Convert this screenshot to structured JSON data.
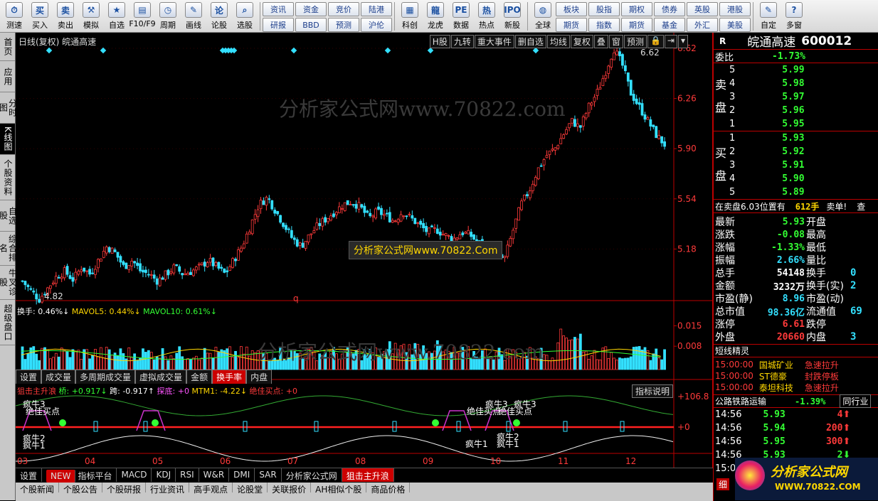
{
  "toolbar": {
    "main_buttons": [
      {
        "label": "测速",
        "icon": "speed-test-icon",
        "glyph": "⏱"
      },
      {
        "label": "买入",
        "icon": "buy-icon",
        "glyph": "买"
      },
      {
        "label": "卖出",
        "icon": "sell-icon",
        "glyph": "卖"
      },
      {
        "label": "模拟",
        "icon": "gavel-icon",
        "glyph": "⚒"
      },
      {
        "label": "自选",
        "icon": "star-icon",
        "glyph": "★"
      },
      {
        "label": "F10/F9",
        "icon": "f10-icon",
        "glyph": "▤"
      },
      {
        "label": "周期",
        "icon": "clock-icon",
        "glyph": "◷"
      },
      {
        "label": "画线",
        "icon": "pencil-icon",
        "glyph": "✎"
      },
      {
        "label": "论股",
        "icon": "forum-icon",
        "glyph": "论"
      },
      {
        "label": "选股",
        "icon": "magnifier-icon",
        "glyph": "⌕"
      }
    ],
    "grid_buttons_1": [
      "资讯",
      "资金",
      "竞价",
      "陆港",
      "研报",
      "BBD",
      "预测",
      "沪伦"
    ],
    "mid_buttons": [
      {
        "label": "科创",
        "icon": "star-market-icon",
        "glyph": "▦"
      },
      {
        "label": "龙虎",
        "icon": "dragon-icon",
        "glyph": "龍"
      },
      {
        "label": "数据",
        "icon": "pe-icon",
        "glyph": "PE"
      },
      {
        "label": "热点",
        "icon": "hot-icon",
        "glyph": "热"
      },
      {
        "label": "新股",
        "icon": "ipo-icon",
        "glyph": "IPO"
      }
    ],
    "globe_button": {
      "label": "全球",
      "icon": "globe-icon",
      "glyph": "◍"
    },
    "grid_buttons_2": [
      "板块",
      "股指",
      "期权",
      "债券",
      "英股",
      "港股",
      "期货",
      "指数",
      "期货",
      "基金",
      "外汇",
      "美股"
    ],
    "right_buttons": [
      {
        "label": "自定",
        "icon": "custom-icon",
        "glyph": "✎"
      },
      {
        "label": "多窗",
        "icon": "multi-window-icon",
        "glyph": "?"
      }
    ]
  },
  "left_nav": [
    {
      "label": "首页",
      "active": false
    },
    {
      "label": "应用",
      "active": false
    },
    {
      "label": "分时图",
      "active": false
    },
    {
      "label": "K线图",
      "active": true
    },
    {
      "label": "个股资料",
      "active": false
    },
    {
      "label": "自选股",
      "active": false
    },
    {
      "label": "综合排名",
      "active": false
    },
    {
      "label": "牛叉诊股",
      "active": false
    },
    {
      "label": "超级盘口",
      "active": false
    }
  ],
  "chart": {
    "title": "日线(复权) 皖通高速",
    "top_buttons": [
      "H股",
      "九转",
      "重大事件",
      "删自选",
      "均线",
      "复权",
      "叠",
      "窗",
      "预测"
    ],
    "watermark": "分析家公式网www.70822.com",
    "center_box": "分析家公式网www.70822.Com",
    "price_axis": [
      "6.62",
      "6.26",
      "5.90",
      "5.54",
      "5.18"
    ],
    "high_label": "6.62",
    "low_label": "4.82",
    "q_marker": "q",
    "volume_legend": {
      "a": "换手: 0.46%↓",
      "b": "MAVOL5: 0.44%↓",
      "c": "MAVOL10: 0.61%↓"
    },
    "volume_axis": [
      "0.015",
      "0.008"
    ],
    "volume_tabs": [
      "设置",
      "成交量",
      "多周期成交量",
      "虚拟成交量",
      "金额",
      "换手率",
      "内盘"
    ],
    "volume_tab_active": "换手率",
    "indicator_legend": {
      "name": "狙击主升浪",
      "a": "桥: +0.917↓",
      "b": "跨: -0.917↑",
      "c": "探底: +0",
      "d": "MTM1: -4.22↓",
      "e": "绝佳买点: +0"
    },
    "indicator_button": "指标说明",
    "indicator_axis": [
      "+106.8",
      "+0"
    ],
    "annotations": [
      "疯牛3",
      "绝佳买点",
      "疯牛1",
      "疯牛2",
      "疯牛3",
      "绝佳买点",
      "绝佳买点",
      "疯牛3",
      "疯牛1",
      "疯牛2",
      "疯牛1"
    ],
    "months": [
      "03",
      "04",
      "05",
      "06",
      "07",
      "08",
      "09",
      "10",
      "11",
      "12"
    ]
  },
  "chart_data": {
    "type": "candlestick",
    "ylim": [
      4.82,
      6.62
    ],
    "price_path": [
      4.95,
      4.88,
      4.82,
      4.9,
      4.98,
      5.02,
      4.96,
      5.05,
      5.0,
      5.1,
      5.2,
      5.15,
      5.05,
      5.1,
      5.02,
      5.0,
      4.95,
      5.0,
      5.05,
      5.0,
      5.02,
      5.05,
      5.1,
      5.05,
      5.0,
      5.1,
      5.2,
      5.35,
      5.5,
      5.55,
      5.45,
      5.35,
      5.25,
      5.2,
      5.28,
      5.35,
      5.4,
      5.45,
      5.5,
      5.52,
      5.48,
      5.4,
      5.45,
      5.42,
      5.38,
      5.45,
      5.4,
      5.35,
      5.3,
      5.32,
      5.28,
      5.25,
      5.3,
      5.28,
      5.22,
      5.2,
      5.15,
      5.1,
      5.3,
      5.5,
      5.6,
      5.75,
      5.85,
      5.9,
      6.0,
      6.1,
      6.05,
      6.2,
      6.3,
      6.45,
      6.62,
      6.5,
      6.3,
      6.2,
      6.1,
      6.0,
      5.93
    ]
  },
  "quote": {
    "r": "R",
    "name": "皖通高速",
    "code": "600012",
    "ratio_label": "委比",
    "ratio": "-1.73%",
    "sell_label": [
      "卖",
      "盘"
    ],
    "buy_label": [
      "买",
      "盘"
    ],
    "sells": [
      [
        "5",
        "5.99"
      ],
      [
        "4",
        "5.98"
      ],
      [
        "3",
        "5.97"
      ],
      [
        "2",
        "5.96"
      ],
      [
        "1",
        "5.95"
      ]
    ],
    "buys": [
      [
        "1",
        "5.93"
      ],
      [
        "2",
        "5.92"
      ],
      [
        "3",
        "5.91"
      ],
      [
        "4",
        "5.90"
      ],
      [
        "5",
        "5.89"
      ]
    ],
    "position_text": "在卖盘6.03位置有",
    "position_qty": "612手",
    "position_type": "卖单!",
    "position_more": "查",
    "stats": [
      [
        "最新",
        "5.93",
        "开盘",
        ""
      ],
      [
        "涨跌",
        "-0.08",
        "最高",
        ""
      ],
      [
        "涨幅",
        "-1.33%",
        "最低",
        ""
      ],
      [
        "振幅",
        "2.66%",
        "量比",
        ""
      ],
      [
        "总手",
        "54148",
        "换手",
        "0"
      ],
      [
        "金额",
        "3232万",
        "换手(实)",
        "2"
      ],
      [
        "市盈(静)",
        "8.96",
        "市盈(动)",
        ""
      ],
      [
        "总市值",
        "98.36亿",
        "流通值",
        "69"
      ],
      [
        "涨停",
        "6.61",
        "跌停",
        ""
      ],
      [
        "外盘",
        "20660",
        "内盘",
        "3"
      ]
    ],
    "feed_title": "短线精灵",
    "feed": [
      [
        "15:00:00",
        "国城矿业",
        "急速拉升"
      ],
      [
        "15:00:00",
        "ST德豪",
        "封跌停板"
      ],
      [
        "15:00:00",
        "泰坦科技",
        "急速拉升"
      ]
    ],
    "sector_name": "公路铁路运输",
    "sector_change": "-1.39%",
    "sector_button": "同行业",
    "ticks": [
      [
        "14:56",
        "5.93",
        "4",
        "up"
      ],
      [
        "14:56",
        "5.94",
        "200",
        "up"
      ],
      [
        "14:56",
        "5.95",
        "300",
        "up"
      ],
      [
        "14:56",
        "5.93",
        "2",
        "down"
      ],
      [
        "15:0",
        "",
        "",
        ""
      ]
    ],
    "detail_tab": "细"
  },
  "bottom_tabs": [
    "设置",
    "指标平台",
    "MACD",
    "KDJ",
    "RSI",
    "W&R",
    "DMI",
    "SAR",
    "分析家公式网",
    "狙击主升浪"
  ],
  "bottom_tab_new": "NEW",
  "bottom_tab_active": "狙击主升浪",
  "news_tabs": [
    "个股新闻",
    "个股公告",
    "个股研报",
    "行业资讯",
    "高手观点",
    "论股堂",
    "关联报价",
    "AH相似个股",
    "商品价格"
  ],
  "logo": {
    "line1": "分析家公式网",
    "line2": "WWW.70822.COM"
  },
  "colors": {
    "red": "#ff3a3a",
    "green": "#33ff33",
    "cyan": "#33e0ff",
    "yellow": "#ffd700",
    "panel_border": "#b00000"
  }
}
